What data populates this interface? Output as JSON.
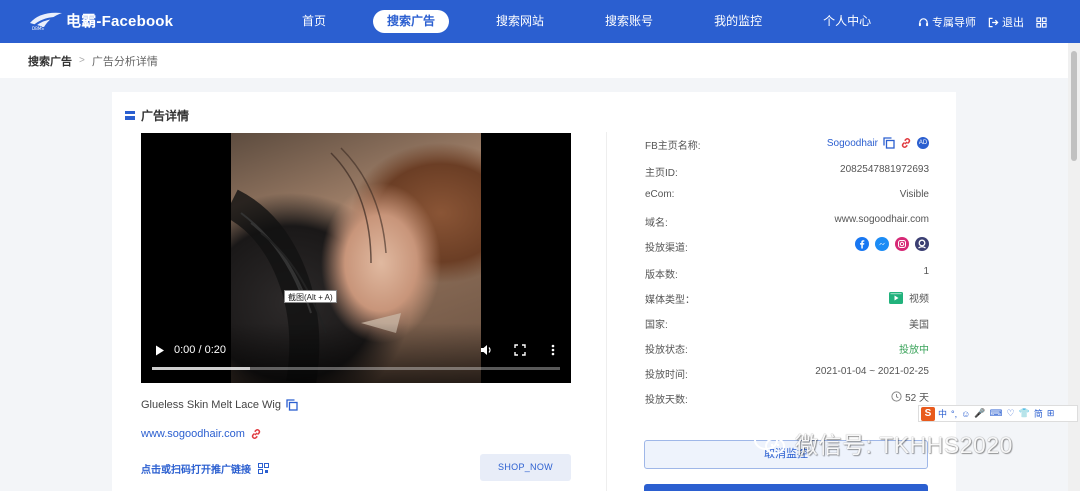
{
  "header": {
    "brand": "电霸-Facebook",
    "nav": [
      {
        "label": "首页",
        "active": false
      },
      {
        "label": "搜索广告",
        "active": true
      },
      {
        "label": "搜索网站",
        "active": false
      },
      {
        "label": "搜索账号",
        "active": false
      },
      {
        "label": "我的监控",
        "active": false
      },
      {
        "label": "个人中心",
        "active": false
      }
    ],
    "support_label": "专属导师",
    "logout_label": "退出",
    "brand_color": "#2b5fd0"
  },
  "breadcrumb": {
    "home": "搜索广告",
    "current": "广告分析详情"
  },
  "card": {
    "title": "广告详情"
  },
  "video": {
    "time": "0:00 / 0:20",
    "tooltip": "截图(Alt + A)",
    "buffered_fraction": 0.24
  },
  "ad": {
    "title": "Glueless Skin Melt Lace Wig",
    "link": "www.sogoodhair.com",
    "qr_label": "点击或扫码打开推广链接",
    "cta": "SHOP_NOW"
  },
  "info": {
    "rows": [
      {
        "label": "FB主页名称:",
        "value": "Sogoodhair",
        "badge": "AD"
      },
      {
        "label": "主页ID:",
        "value": "2082547881972693"
      },
      {
        "label": "eCom:",
        "value": "Visible"
      },
      {
        "label": "域名:",
        "value": "www.sogoodhair.com"
      },
      {
        "label": "投放渠道:",
        "channels": [
          "facebook-icon",
          "messenger-icon",
          "instagram-icon",
          "audience-network-icon"
        ]
      },
      {
        "label": "版本数:",
        "value": "1"
      },
      {
        "label": "媒体类型：",
        "value": "视频"
      },
      {
        "label": "国家:",
        "value": "美国"
      },
      {
        "label": "投放状态:",
        "value": "投放中"
      },
      {
        "label": "投放时间:",
        "value": "2021-01-04 ~ 2021-02-25"
      },
      {
        "label": "投放天数:",
        "value": "52 天"
      }
    ],
    "green": "#3aa35a",
    "outline_button": "取消监控"
  },
  "ime": {
    "logo": "S",
    "items": [
      "中",
      "°,",
      "☺",
      "🎤",
      "⌨",
      "♡",
      "👕",
      "简",
      "⊞"
    ]
  },
  "watermark": {
    "text": "微信号: TKHHS2020"
  }
}
